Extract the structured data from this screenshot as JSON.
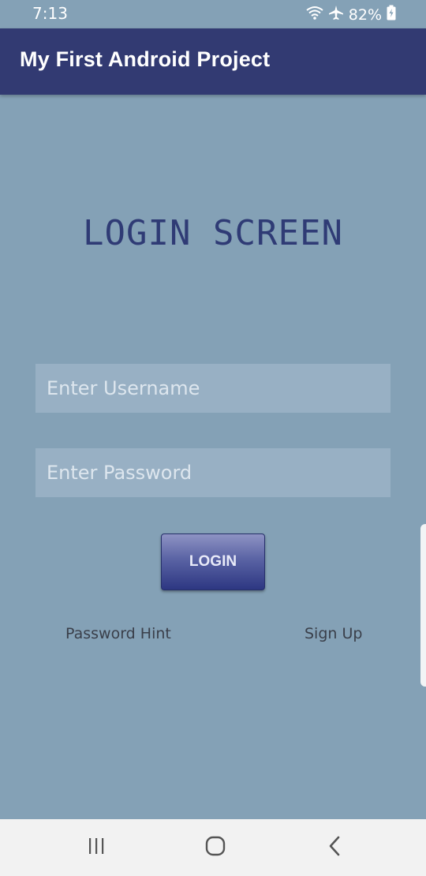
{
  "status_bar": {
    "time": "7:13",
    "battery": "82%",
    "icons": [
      "wifi-icon",
      "airplane-icon",
      "battery-charging-icon"
    ]
  },
  "app_bar": {
    "title": "My First Android Project",
    "color": "#323a72"
  },
  "screen": {
    "title": "LOGIN SCREEN",
    "background": "#84a1b6"
  },
  "form": {
    "username_placeholder": "Enter Username",
    "username_value": "",
    "password_placeholder": "Enter Password",
    "password_value": "",
    "login_label": "LOGIN"
  },
  "links": {
    "password_hint": "Password Hint",
    "sign_up": "Sign Up"
  },
  "nav_bar": {
    "buttons": [
      "recent-apps-icon",
      "home-icon",
      "back-icon"
    ]
  }
}
